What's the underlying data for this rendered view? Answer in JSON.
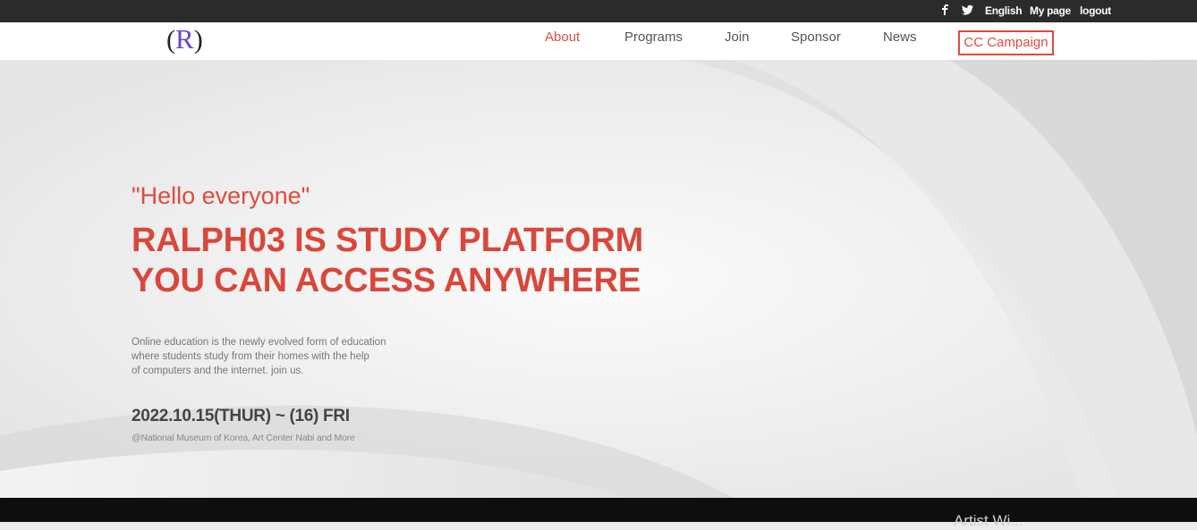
{
  "topbar": {
    "facebook_icon": "f",
    "twitter_icon": "t",
    "language": "English",
    "mypage": "My page",
    "logout": "logout"
  },
  "logo": {
    "left_paren": "(",
    "letter": "R",
    "right_paren": ")"
  },
  "nav": {
    "items": [
      {
        "label": "About",
        "active": true
      },
      {
        "label": "Programs"
      },
      {
        "label": "Join"
      },
      {
        "label": "Sponsor"
      },
      {
        "label": "News"
      }
    ],
    "cta": "CC Campaign"
  },
  "hero": {
    "greeting": "\"Hello everyone\"",
    "headline_line1": "RALPH03 IS STUDY PLATFORM",
    "headline_line2": "YOU CAN ACCESS ANYWHERE",
    "desc_line1": "Online education is the newly evolved form of education",
    "desc_line2": "where students study from their homes with the help",
    "desc_line3": "of computers and the internet. join us.",
    "date": "2022.10.15(THUR) ~ (16) FRI",
    "venue": "@National Museum of Korea, Art Center Nabi and More"
  },
  "bottom": {
    "peek_text": "Artist Wi..."
  },
  "colors": {
    "accent": "#e04b3f",
    "topbar": "#2b2b2b",
    "footer": "#0e0e0e"
  }
}
